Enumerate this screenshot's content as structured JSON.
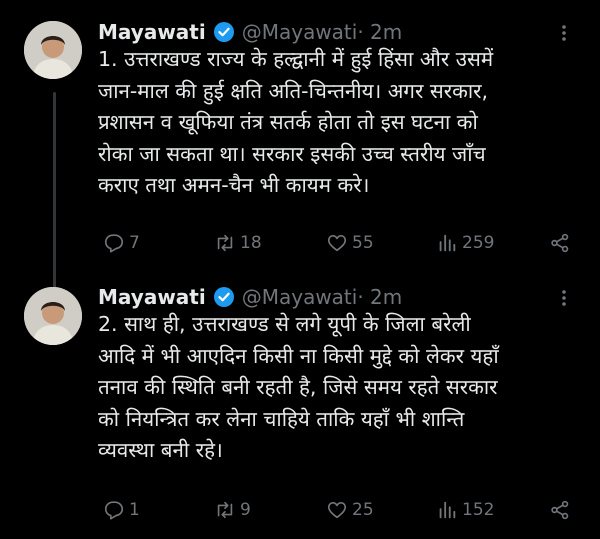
{
  "tweets": [
    {
      "author_name": "Mayawati",
      "handle": "@Mayawati",
      "time": " · 2m",
      "text": "1. उत्तराखण्ड राज्य के हल्द्वानी में हुई हिंसा और उसमें\nजान-माल की हुई क्षति अति-चिन्तनीय। अगर सरकार,\nप्रशासन व खूफिया तंत्र सतर्क होता तो इस घटना को\nरोका जा सकता था। सरकार इसकी उच्च स्तरीय जाँच\nकराए तथा अमन-चैन भी कायम करे।",
      "replies": "7",
      "retweets": "18",
      "likes": "55",
      "views": "259"
    },
    {
      "author_name": "Mayawati",
      "handle": "@Mayawati",
      "time": " · 2m",
      "text": "2. साथ ही, उत्तराखण्ड से लगे यूपी के जिला बरेली\nआदि में भी आएदिन किसी ना किसी मुद्दे को लेकर यहाँ\nतनाव की स्थिति बनी रहती है, जिसे समय रहते सरकार\nको नियन्त्रित कर लेना चाहिये ताकि यहाँ भी शान्ति\nव्यवस्था बनी रहे।",
      "replies": "1",
      "retweets": "9",
      "likes": "25",
      "views": "152"
    }
  ],
  "colors": {
    "background": "#000000",
    "text": "#e7e9ea",
    "muted": "#71767b",
    "verified": "#1d9bf0"
  }
}
